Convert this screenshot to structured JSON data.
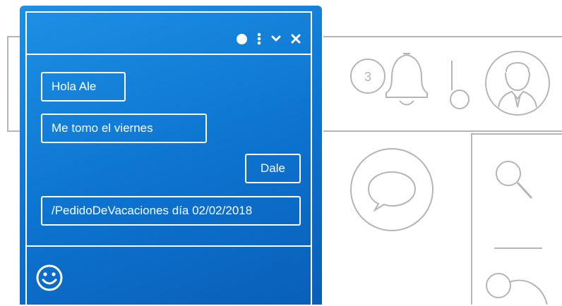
{
  "background": {
    "notification_count": "3",
    "icons": [
      "bell-icon",
      "user-avatar-icon",
      "chat-bubble-icon",
      "search-icon",
      "person-icon"
    ]
  },
  "chat": {
    "header": {
      "icons": [
        "status-dot-icon",
        "more-vertical-icon",
        "chevron-down-icon",
        "close-icon"
      ]
    },
    "messages": [
      {
        "text": "Hola Ale",
        "side": "left"
      },
      {
        "text": "Me tomo el viernes",
        "side": "left"
      },
      {
        "text": "Dale",
        "side": "right"
      },
      {
        "text": "/PedidoDeVacaciones día 02/02/2018",
        "side": "left"
      }
    ],
    "footer": {
      "icon": "smiley-icon"
    }
  },
  "colors": {
    "chat_blue": "#0c73cf",
    "chat_blue_light": "#1e90e4",
    "line_gray": "#b5b5b5",
    "white": "#ffffff"
  }
}
